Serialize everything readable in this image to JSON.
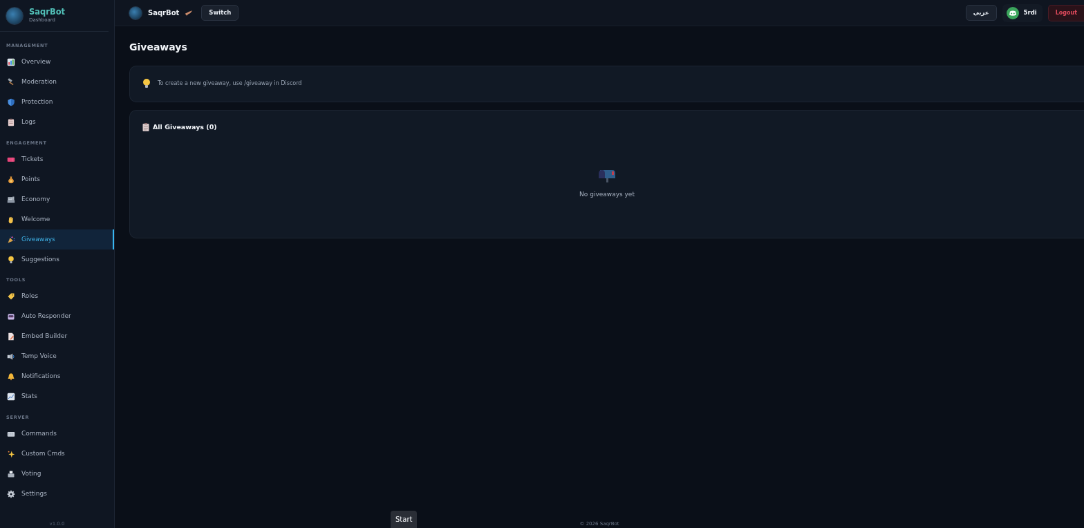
{
  "brand": {
    "name": "SaqrBot",
    "subtitle": "Dashboard"
  },
  "sidebar": {
    "sections": [
      {
        "title": "MANAGEMENT",
        "items": [
          {
            "label": "Overview",
            "selected": false
          },
          {
            "label": "Moderation",
            "selected": false
          },
          {
            "label": "Protection",
            "selected": false
          },
          {
            "label": "Logs",
            "selected": false
          }
        ]
      },
      {
        "title": "ENGAGEMENT",
        "items": [
          {
            "label": "Tickets",
            "selected": false
          },
          {
            "label": "Points",
            "selected": false
          },
          {
            "label": "Economy",
            "selected": false
          },
          {
            "label": "Welcome",
            "selected": false
          },
          {
            "label": "Giveaways",
            "selected": true
          },
          {
            "label": "Suggestions",
            "selected": false
          }
        ]
      },
      {
        "title": "TOOLS",
        "items": [
          {
            "label": "Roles",
            "selected": false
          },
          {
            "label": "Auto Responder",
            "selected": false
          },
          {
            "label": "Embed Builder",
            "selected": false
          },
          {
            "label": "Temp Voice",
            "selected": false
          },
          {
            "label": "Notifications",
            "selected": false
          },
          {
            "label": "Stats",
            "selected": false
          }
        ]
      },
      {
        "title": "SERVER",
        "items": [
          {
            "label": "Commands",
            "selected": false
          },
          {
            "label": "Custom Cmds",
            "selected": false
          },
          {
            "label": "Voting",
            "selected": false
          },
          {
            "label": "Settings",
            "selected": false
          }
        ]
      }
    ],
    "version": "v1.0.0"
  },
  "topbar": {
    "server_name": "SaqrBot",
    "switch_button": "Switch",
    "language_button": "عربي",
    "username": "5rdi",
    "logout_button": "Logout"
  },
  "page": {
    "title": "Giveaways",
    "info": "To create a new giveaway, use /giveaway in Discord",
    "list_title": "All Giveaways (0)",
    "empty_text": "No giveaways yet"
  },
  "start_button": "Start",
  "footer": "© 2026 SaqrBot"
}
